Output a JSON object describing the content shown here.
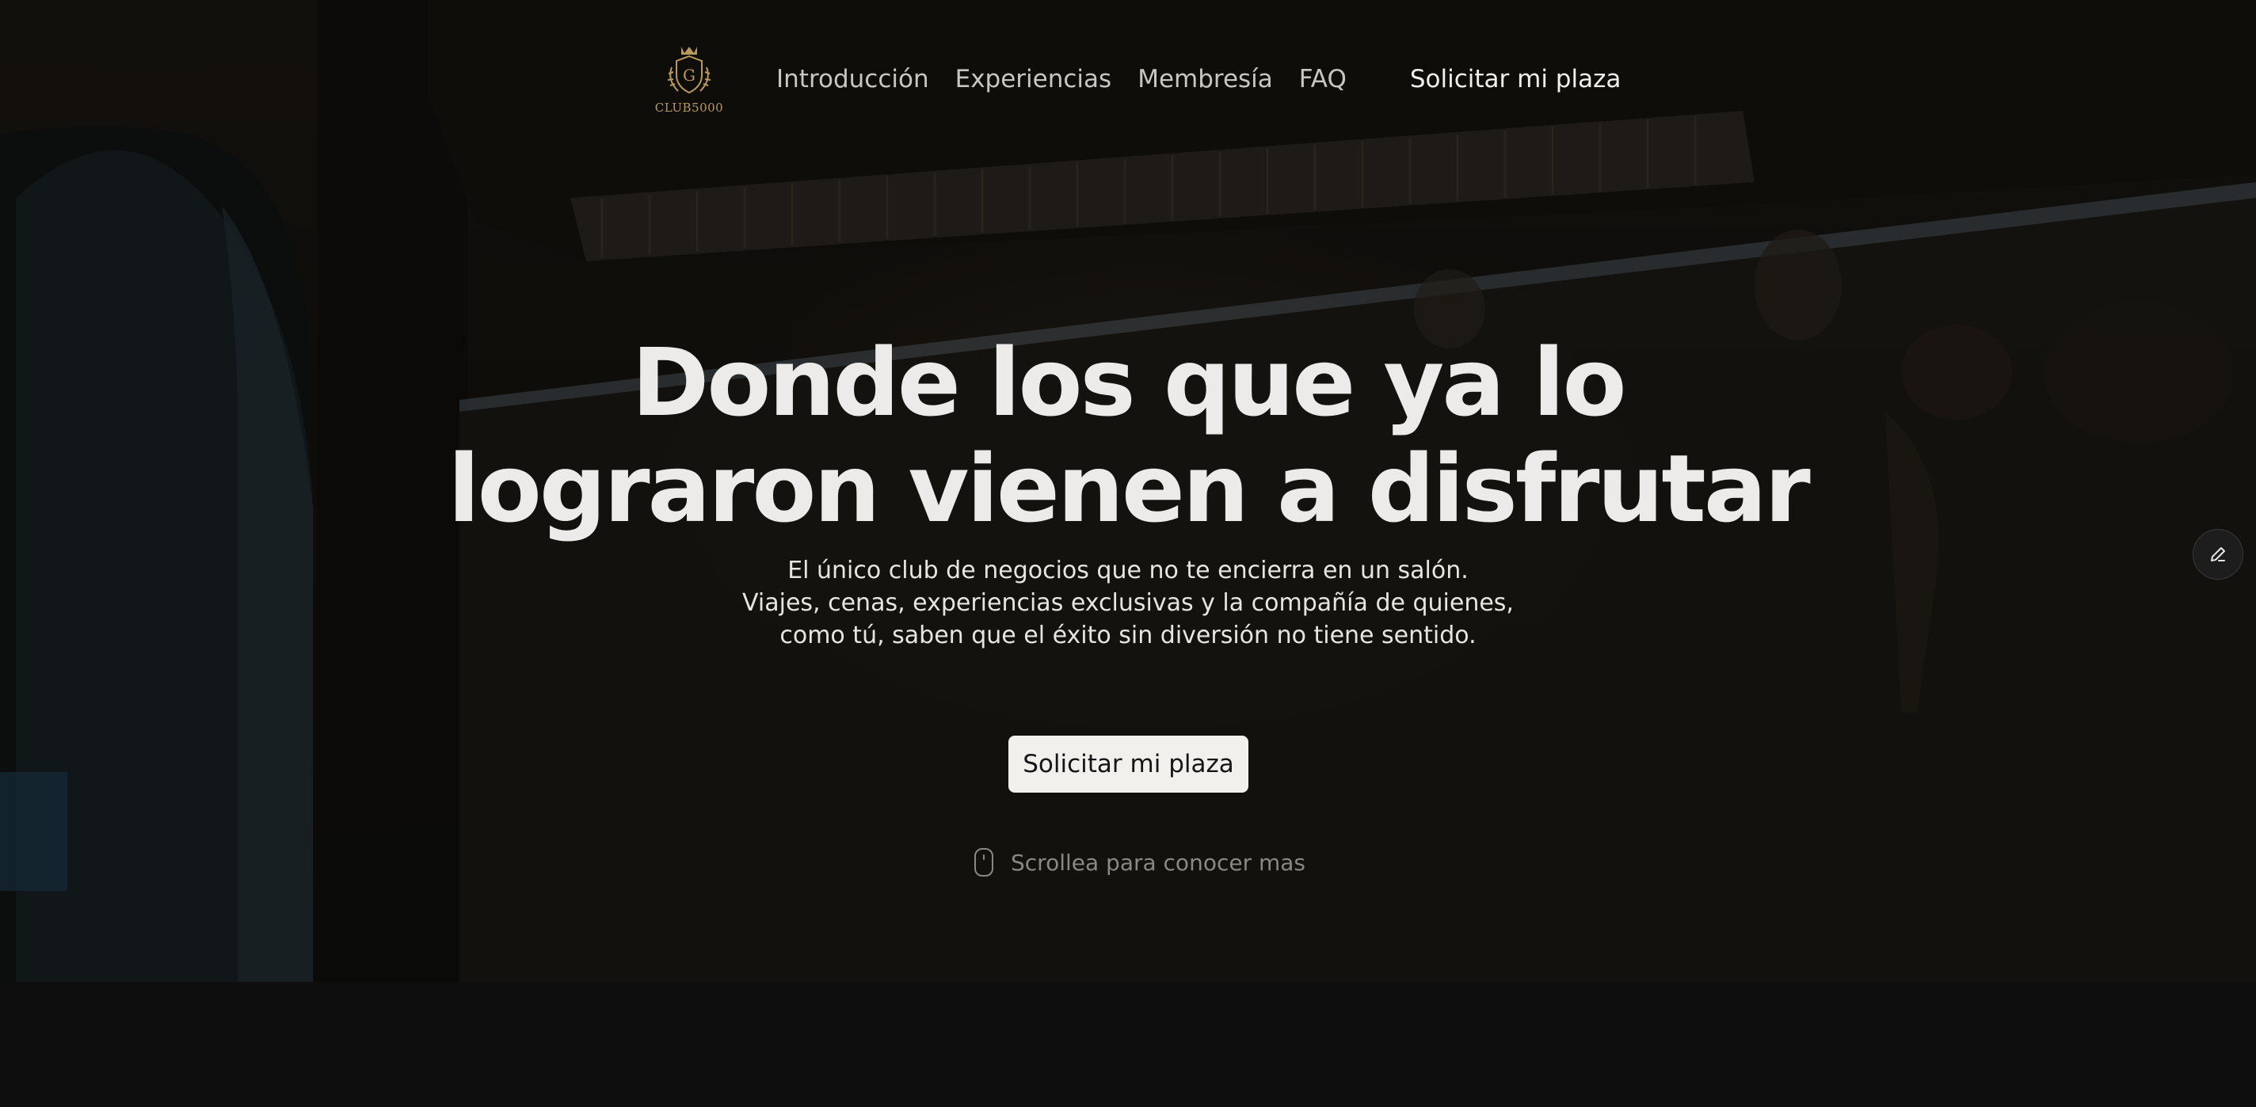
{
  "brand": {
    "logo_text": "CLUB5000",
    "logo_icon": "crest-icon",
    "accent": "#b79a5a"
  },
  "nav": {
    "links": [
      "Introducción",
      "Experiencias",
      "Membresía",
      "FAQ"
    ],
    "cta": "Solicitar mi plaza"
  },
  "hero": {
    "headline_line1": "Donde los que ya lo",
    "headline_line2": "lograron vienen a disfrutar",
    "sub_line1": "El único club de negocios que no te encierra en un salón.",
    "sub_line2": "Viajes, cenas, experiencias exclusivas y la compañía de quienes,",
    "sub_line3": "como tú, saben que el éxito sin diversión no tiene sentido.",
    "cta": "Solicitar mi plaza",
    "scroll_hint": "Scrollea para conocer mas",
    "scroll_icon": "mouse-icon"
  },
  "floating": {
    "edit_icon": "pencil-icon"
  }
}
